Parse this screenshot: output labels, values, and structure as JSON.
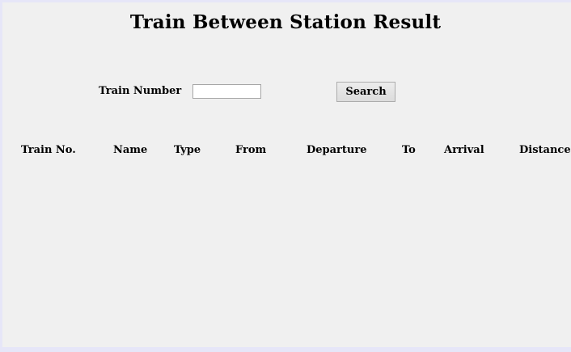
{
  "page": {
    "title": "Train Between Station Result"
  },
  "search": {
    "train_number_label": "Train Number",
    "train_number_value": "",
    "train_number_placeholder": "",
    "search_button_label": "Search"
  },
  "table": {
    "columns": [
      "Train No.",
      "Name",
      "Type",
      "From",
      "Departure",
      "To",
      "Arrival",
      "Distance"
    ],
    "rows": []
  }
}
